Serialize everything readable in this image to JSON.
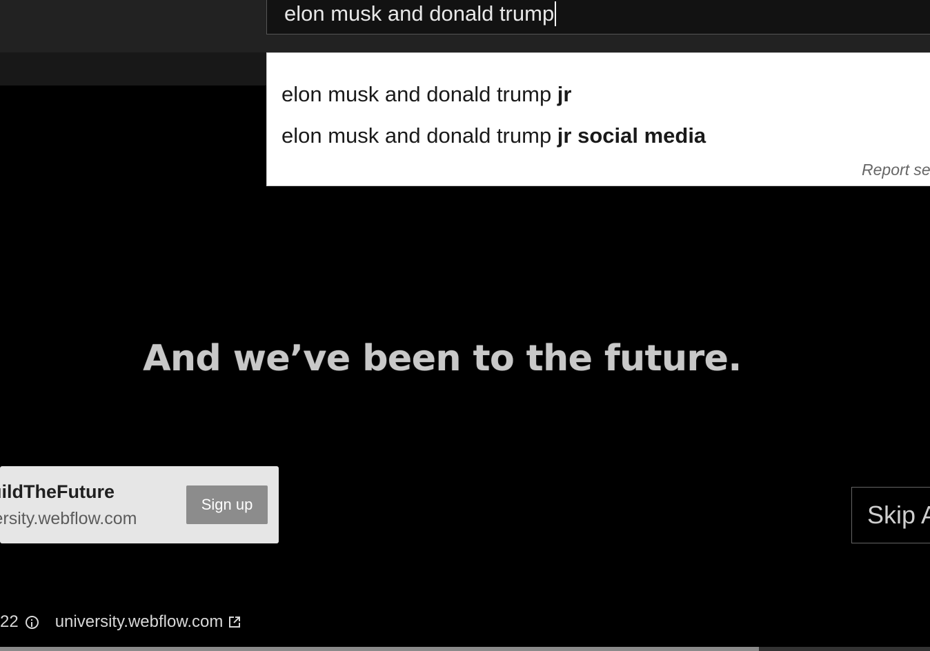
{
  "search": {
    "query": "elon musk and donald trump"
  },
  "suggestions": {
    "items": [
      {
        "prefix": "elon musk and donald trump ",
        "completion": "jr"
      },
      {
        "prefix": "elon musk and donald trump ",
        "completion": "jr social media"
      }
    ],
    "report_label": "Report se"
  },
  "video": {
    "headline": "And we’ve been to the future."
  },
  "ad": {
    "title": "uildTheFuture",
    "url": "versity.webflow.com",
    "signup_label": "Sign up",
    "skip_label": "Skip A",
    "counter": "22",
    "domain": "university.webflow.com",
    "progress_fraction": 0.816
  },
  "colors": {
    "background": "#000000",
    "masthead": "#222222",
    "dropdown": "#ffffff",
    "ad_card": "#e6e6e6",
    "signup_button": "#8c8c8c"
  }
}
